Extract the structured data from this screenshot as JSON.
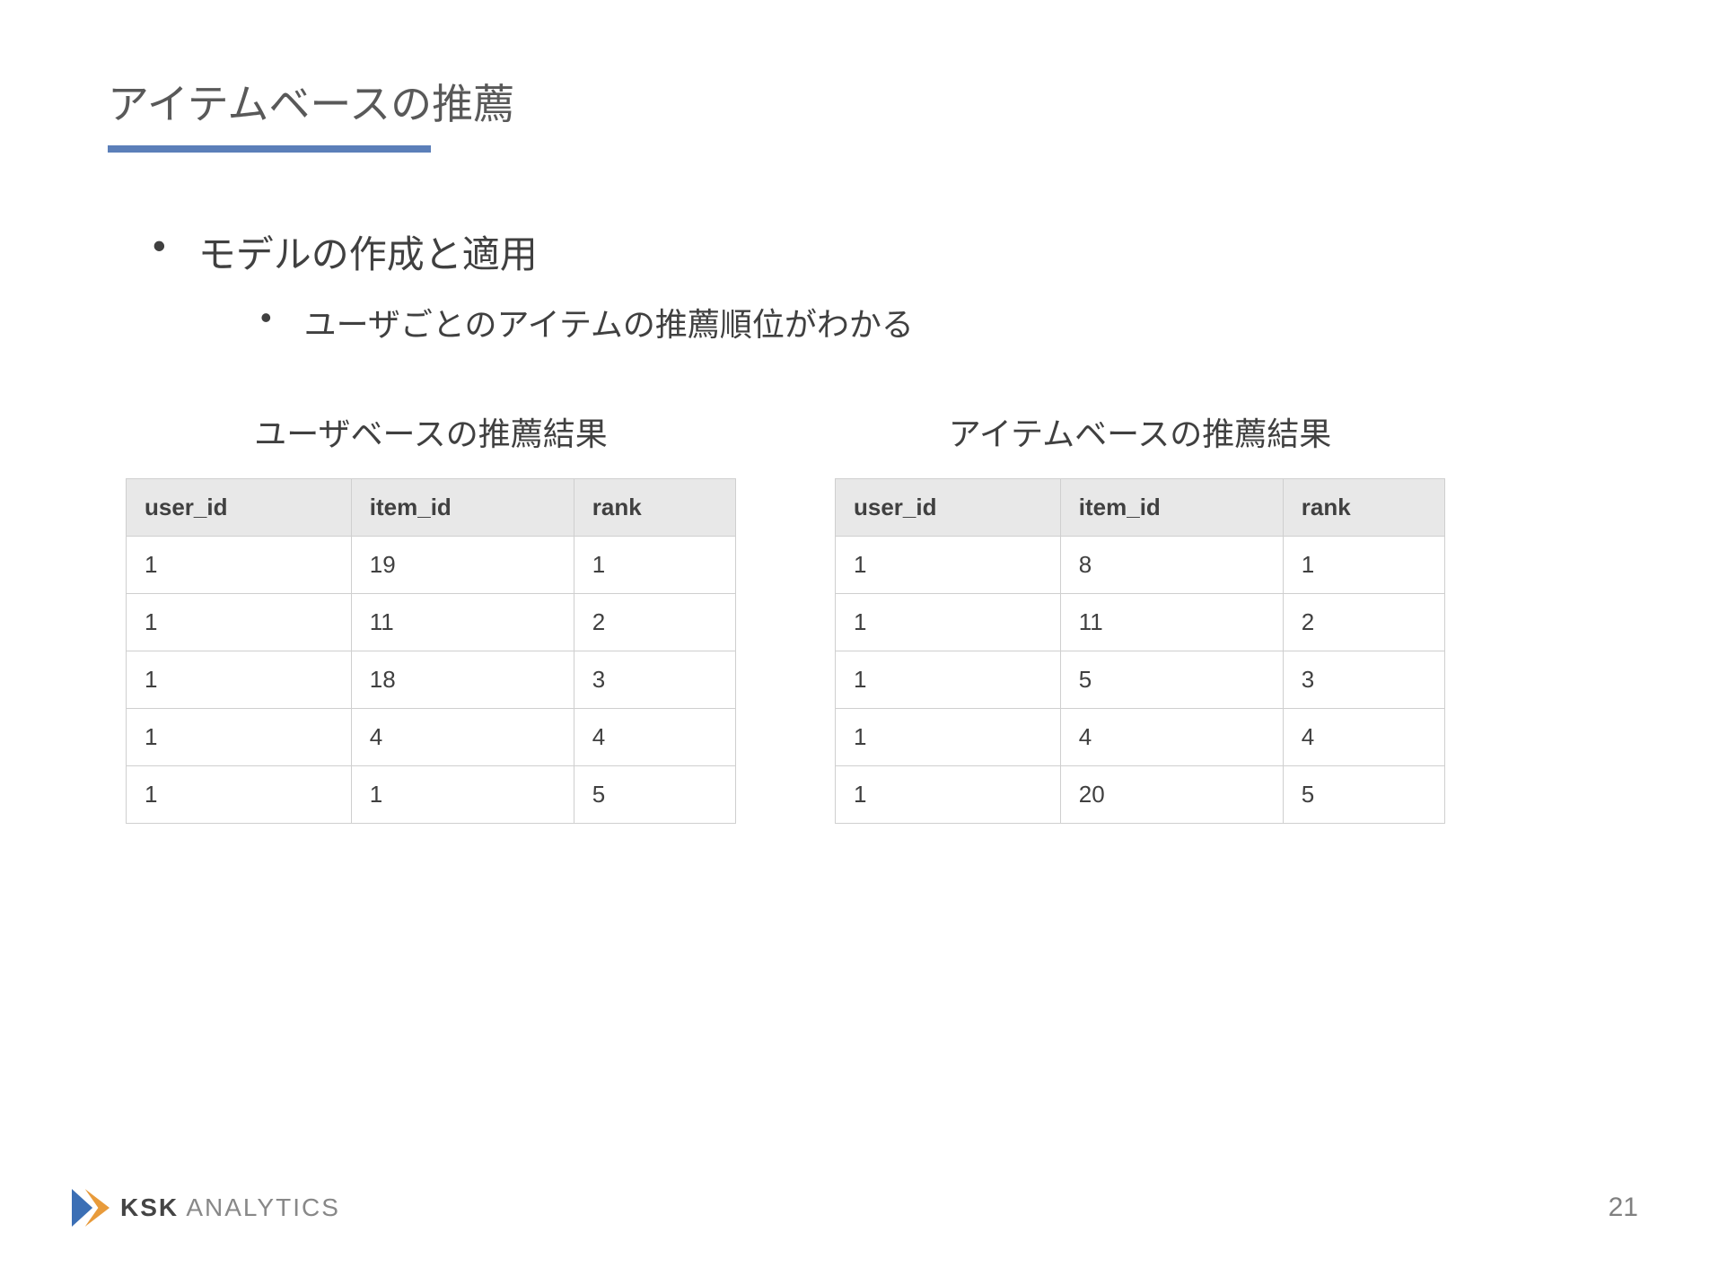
{
  "title": "アイテムベースの推薦",
  "bullets": {
    "level1": "モデルの作成と適用",
    "level2": "ユーザごとのアイテムの推薦順位がわかる"
  },
  "tables": {
    "left": {
      "caption": "ユーザベースの推薦結果",
      "headers": [
        "user_id",
        "item_id",
        "rank"
      ],
      "rows": [
        [
          "1",
          "19",
          "1"
        ],
        [
          "1",
          "11",
          "2"
        ],
        [
          "1",
          "18",
          "3"
        ],
        [
          "1",
          "4",
          "4"
        ],
        [
          "1",
          "1",
          "5"
        ]
      ]
    },
    "right": {
      "caption": "アイテムベースの推薦結果",
      "headers": [
        "user_id",
        "item_id",
        "rank"
      ],
      "rows": [
        [
          "1",
          "8",
          "1"
        ],
        [
          "1",
          "11",
          "2"
        ],
        [
          "1",
          "5",
          "3"
        ],
        [
          "1",
          "4",
          "4"
        ],
        [
          "1",
          "20",
          "5"
        ]
      ]
    }
  },
  "footer": {
    "logo_bold": "KSK",
    "logo_light": " ANALYTICS",
    "page_number": "21"
  },
  "chart_data": [
    {
      "type": "table",
      "title": "ユーザベースの推薦結果",
      "columns": [
        "user_id",
        "item_id",
        "rank"
      ],
      "rows": [
        [
          1,
          19,
          1
        ],
        [
          1,
          11,
          2
        ],
        [
          1,
          18,
          3
        ],
        [
          1,
          4,
          4
        ],
        [
          1,
          1,
          5
        ]
      ]
    },
    {
      "type": "table",
      "title": "アイテムベースの推薦結果",
      "columns": [
        "user_id",
        "item_id",
        "rank"
      ],
      "rows": [
        [
          1,
          8,
          1
        ],
        [
          1,
          11,
          2
        ],
        [
          1,
          5,
          3
        ],
        [
          1,
          4,
          4
        ],
        [
          1,
          20,
          5
        ]
      ]
    }
  ]
}
